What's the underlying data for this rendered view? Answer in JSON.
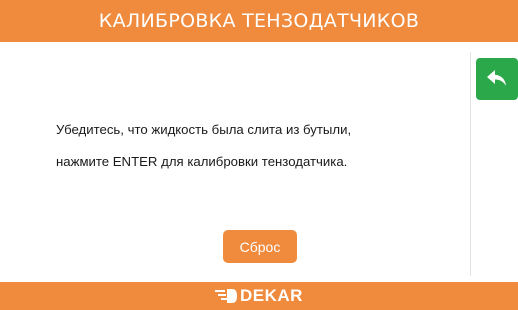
{
  "header": {
    "title": "КАЛИБРОВКА ТЕНЗОДАТЧИКОВ"
  },
  "back_button": {
    "icon": "undo-arrow-icon",
    "color": "#2aa84a"
  },
  "message": {
    "line1": "Убедитесь, что жидкость была слита из бутыли,",
    "line2": "нажмите  ENTER для калибровки тензодатчика."
  },
  "reset_button": {
    "label": "Сброс"
  },
  "footer": {
    "logo_text": "DEKAR",
    "logo_icon": "dekar-logo-mark"
  },
  "colors": {
    "accent": "#f08a3c",
    "back": "#2aa84a",
    "text": "#1a1a1a"
  }
}
